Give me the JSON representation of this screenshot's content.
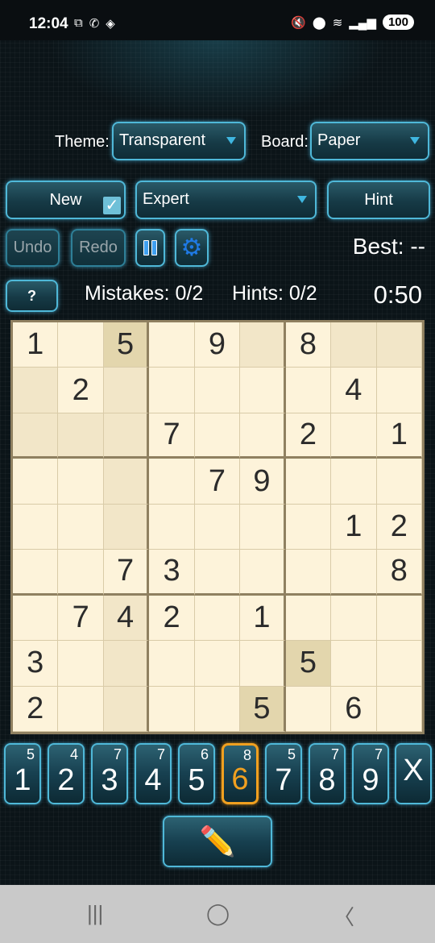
{
  "status_bar": {
    "time": "12:04",
    "left_icons": [
      "screenshot-icon",
      "missed-call-icon",
      "app-icon"
    ],
    "right_icons": [
      "mute-icon",
      "location-icon",
      "wifi-icon",
      "signal-icon"
    ],
    "battery": "100"
  },
  "controls": {
    "theme_label": "Theme:",
    "theme_value": "Transparent",
    "board_label": "Board:",
    "board_value": "Paper",
    "new_label": "New",
    "difficulty_value": "Expert",
    "hint_label": "Hint",
    "undo_label": "Undo",
    "redo_label": "Redo",
    "best_label": "Best: --",
    "help_label": "?",
    "mistakes": "Mistakes: 0/2",
    "hints": "Hints: 0/2",
    "timer": "0:50"
  },
  "board": [
    [
      "1",
      "",
      "5",
      "",
      "9",
      "",
      "8",
      "",
      ""
    ],
    [
      "",
      "2",
      "",
      "",
      "",
      "",
      "",
      "4",
      ""
    ],
    [
      "",
      "",
      "",
      "7",
      "",
      "",
      "2",
      "",
      "1"
    ],
    [
      "",
      "",
      "",
      "",
      "7",
      "9",
      "",
      "",
      ""
    ],
    [
      "",
      "",
      "",
      "",
      "",
      "",
      "",
      "1",
      "2"
    ],
    [
      "",
      "",
      "7",
      "3",
      "",
      "",
      "",
      "",
      "8"
    ],
    [
      "",
      "7",
      "4",
      "2",
      "",
      "1",
      "",
      "",
      ""
    ],
    [
      "3",
      "",
      "",
      "",
      "",
      "",
      "5",
      "",
      ""
    ],
    [
      "2",
      "",
      "",
      "",
      "",
      "5",
      "",
      "6",
      ""
    ]
  ],
  "number_pad": [
    {
      "digit": "1",
      "remaining": "5"
    },
    {
      "digit": "2",
      "remaining": "4"
    },
    {
      "digit": "3",
      "remaining": "7"
    },
    {
      "digit": "4",
      "remaining": "7"
    },
    {
      "digit": "5",
      "remaining": "6"
    },
    {
      "digit": "6",
      "remaining": "8"
    },
    {
      "digit": "7",
      "remaining": "5"
    },
    {
      "digit": "8",
      "remaining": "7"
    },
    {
      "digit": "9",
      "remaining": "7"
    }
  ],
  "clear_key": "X",
  "selected_digit": "6",
  "colors": {
    "accent_glow": "#4fb8d8",
    "selected_key": "#f0a020",
    "board_bg": "#fdf3da",
    "board_border": "#8f8060"
  }
}
